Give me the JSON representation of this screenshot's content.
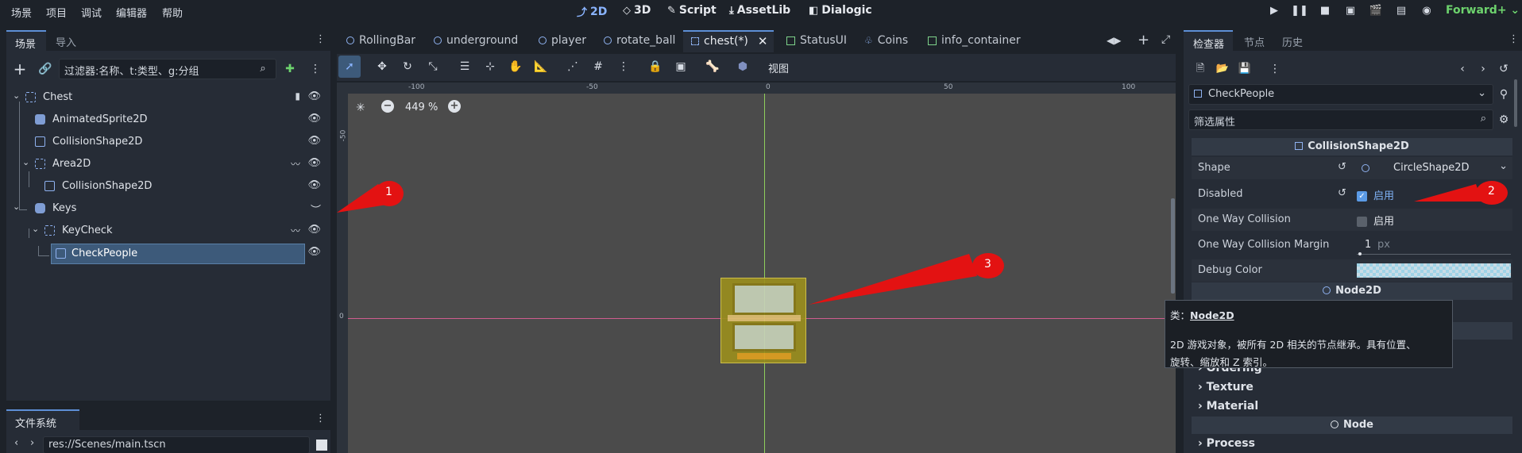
{
  "menubar": {
    "items": [
      "场景",
      "项目",
      "调试",
      "编辑器",
      "帮助"
    ],
    "modes": [
      {
        "icon": "2d-icon",
        "label": "2D"
      },
      {
        "icon": "3d-icon",
        "label": "3D"
      },
      {
        "icon": "script-icon",
        "label": "Script"
      },
      {
        "icon": "assetlib-icon",
        "label": "AssetLib"
      },
      {
        "icon": "dialogic-icon",
        "label": "Dialogic"
      }
    ],
    "renderer": "Forward+"
  },
  "scene_dock": {
    "tabs": [
      "场景",
      "导入"
    ],
    "filter_placeholder": "过滤器:名称、t:类型、g:分组",
    "tree": [
      {
        "label": "Chest"
      },
      {
        "label": "AnimatedSprite2D"
      },
      {
        "label": "CollisionShape2D"
      },
      {
        "label": "Area2D"
      },
      {
        "label": "CollisionShape2D"
      },
      {
        "label": "Keys"
      },
      {
        "label": "KeyCheck"
      },
      {
        "label": "CheckPeople"
      }
    ]
  },
  "filesystem_dock": {
    "title": "文件系统",
    "path": "res://Scenes/main.tscn"
  },
  "scene_tabs": [
    "RollingBar",
    "underground",
    "player",
    "rotate_ball",
    "chest(*)",
    "StatusUI",
    "Coins",
    "info_container"
  ],
  "viewport": {
    "view_menu": "视图",
    "zoom": "449 %",
    "ruler_labels": [
      "-100",
      "-50",
      "0",
      "50",
      "100"
    ],
    "vruler_labels": [
      "-50",
      "0"
    ]
  },
  "inspector": {
    "tabs": [
      "检查器",
      "节点",
      "历史"
    ],
    "node_name": "CheckPeople",
    "filter_placeholder": "筛选属性",
    "section_collision": "CollisionShape2D",
    "props": {
      "shape_label": "Shape",
      "shape_value": "CircleShape2D",
      "disabled_label": "Disabled",
      "disabled_value": "启用",
      "oneway_label": "One Way Collision",
      "oneway_value": "启用",
      "margin_label": "One Way Collision Margin",
      "margin_value": "1",
      "margin_unit": "px",
      "debug_color_label": "Debug Color"
    },
    "section_node2d": "Node2D",
    "subsections": [
      "Ordering",
      "Texture",
      "Material"
    ],
    "section_node": "Node",
    "process_label": "Process"
  },
  "tooltip": {
    "class_prefix": "类：",
    "class_name": "Node2D",
    "line1": "2D 游戏对象，被所有 2D 相关的节点继承。具有位置、",
    "line2": "旋转、缩放和 Z 索引。"
  },
  "callouts": [
    "1",
    "2",
    "3"
  ]
}
